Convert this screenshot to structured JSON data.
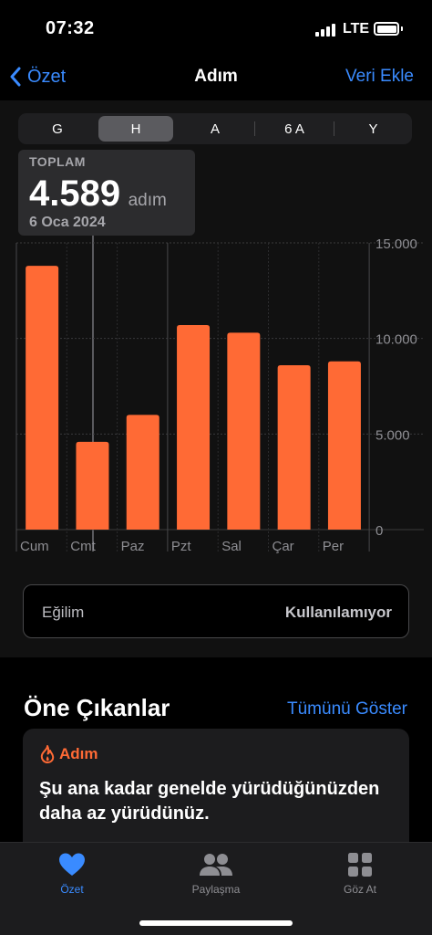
{
  "status_bar": {
    "time": "07:32",
    "network": "LTE"
  },
  "nav": {
    "back_label": "Özet",
    "title": "Adım",
    "action_label": "Veri Ekle"
  },
  "segments": [
    "G",
    "H",
    "A",
    "6 A",
    "Y"
  ],
  "selected_segment": "H",
  "tooltip": {
    "label": "TOPLAM",
    "value": "4.589",
    "unit": "adım",
    "date": "6 Oca 2024"
  },
  "chart_data": {
    "type": "bar",
    "categories": [
      "Cum",
      "Cmt",
      "Paz",
      "Pzt",
      "Sal",
      "Çar",
      "Per"
    ],
    "values": [
      13800,
      4589,
      6000,
      10700,
      10300,
      8600,
      8800
    ],
    "y_ticks": [
      {
        "value": 0,
        "label": "0"
      },
      {
        "value": 5000,
        "label": "5.000"
      },
      {
        "value": 10000,
        "label": "10.000"
      },
      {
        "value": 15000,
        "label": "15.000"
      }
    ],
    "ylim": [
      0,
      15000
    ],
    "selected_index": 1,
    "bar_color": "#ff6a35",
    "grid": true
  },
  "trend": {
    "label": "Eğilim",
    "value": "Kullanılamıyor"
  },
  "highlights": {
    "title": "Öne Çıkanlar",
    "link": "Tümünü Göster",
    "card": {
      "category": "Adım",
      "text": "Şu ana kadar genelde yürüdüğünüzden daha az yürüdünüz."
    }
  },
  "tab_bar": {
    "items": [
      {
        "label": "Özet",
        "icon": "heart-icon",
        "active": true
      },
      {
        "label": "Paylaşma",
        "icon": "people-icon",
        "active": false
      },
      {
        "label": "Göz At",
        "icon": "grid-icon",
        "active": false
      }
    ]
  },
  "colors": {
    "accent": "#3a8bff",
    "bar": "#ff6a35",
    "background": "#000000"
  }
}
